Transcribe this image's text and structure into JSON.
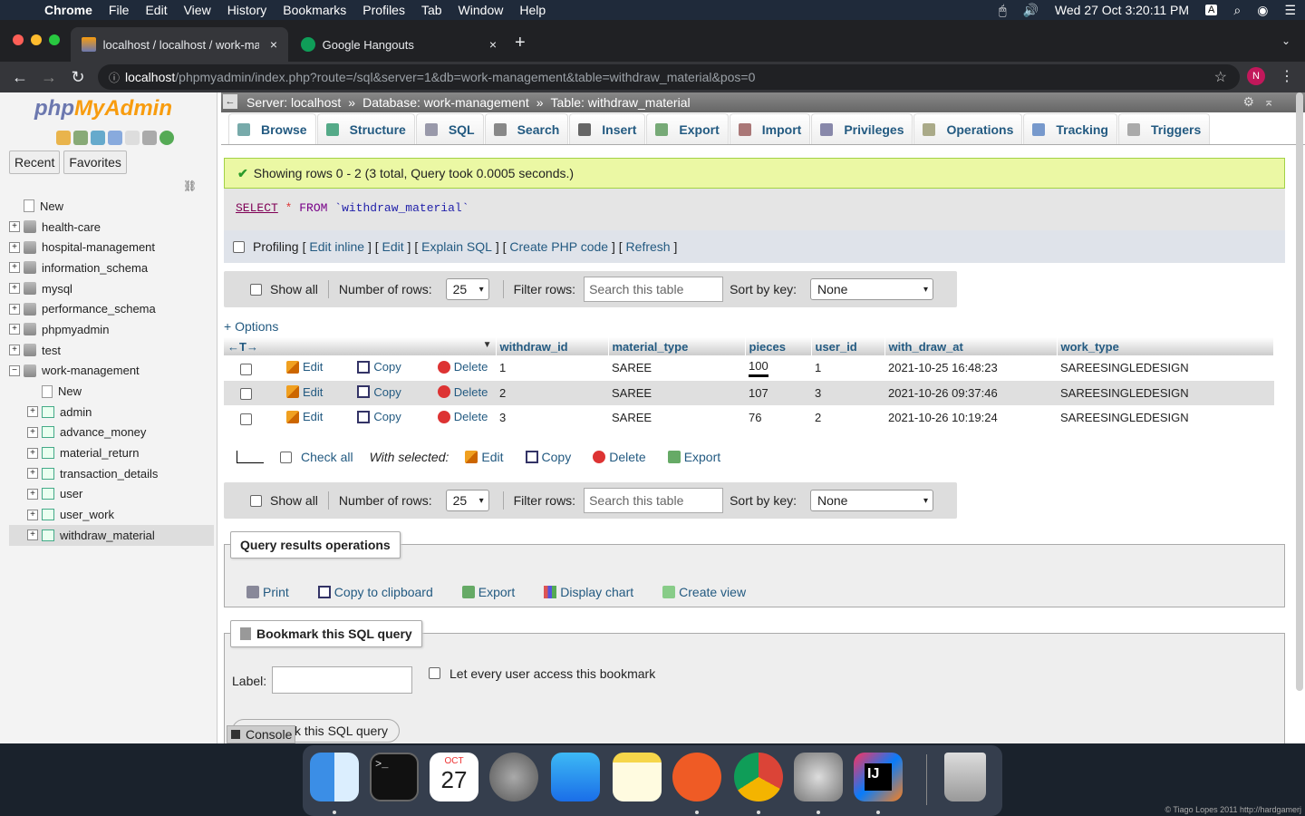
{
  "menubar": {
    "app": "Chrome",
    "items": [
      "File",
      "Edit",
      "View",
      "History",
      "Bookmarks",
      "Profiles",
      "Tab",
      "Window",
      "Help"
    ],
    "datetime": "Wed 27 Oct  3:20:11 PM",
    "input_indicator": "A"
  },
  "tabs": [
    {
      "title": "localhost / localhost / work-ma",
      "close": "×"
    },
    {
      "title": "Google Hangouts",
      "close": "×"
    }
  ],
  "newtab": "+",
  "address": {
    "host": "localhost",
    "path": "/phpmyadmin/index.php?route=/sql&server=1&db=work-management&table=withdraw_material&pos=0",
    "profile_initial": "N"
  },
  "nav": {
    "logo_php": "php",
    "logo_my": "MyAdmin",
    "tabs": [
      "Recent",
      "Favorites"
    ],
    "tree": [
      {
        "label": "New",
        "type": "new",
        "level": 0
      },
      {
        "label": "health-care",
        "type": "db",
        "level": 0
      },
      {
        "label": "hospital-management",
        "type": "db",
        "level": 0
      },
      {
        "label": "information_schema",
        "type": "db",
        "level": 0
      },
      {
        "label": "mysql",
        "type": "db",
        "level": 0
      },
      {
        "label": "performance_schema",
        "type": "db",
        "level": 0
      },
      {
        "label": "phpmyadmin",
        "type": "db",
        "level": 0
      },
      {
        "label": "test",
        "type": "db",
        "level": 0
      },
      {
        "label": "work-management",
        "type": "db-open",
        "level": 0
      },
      {
        "label": "New",
        "type": "new",
        "level": 1
      },
      {
        "label": "admin",
        "type": "table",
        "level": 1
      },
      {
        "label": "advance_money",
        "type": "table",
        "level": 1
      },
      {
        "label": "material_return",
        "type": "table",
        "level": 1
      },
      {
        "label": "transaction_details",
        "type": "table",
        "level": 1
      },
      {
        "label": "user",
        "type": "table",
        "level": 1
      },
      {
        "label": "user_work",
        "type": "table",
        "level": 1
      },
      {
        "label": "withdraw_material",
        "type": "table",
        "level": 1,
        "selected": true
      }
    ]
  },
  "breadcrumb": {
    "server": "Server: localhost",
    "database": "Database: work-management",
    "table": "Table: withdraw_material",
    "sep": "»"
  },
  "menu_tabs": [
    "Browse",
    "Structure",
    "SQL",
    "Search",
    "Insert",
    "Export",
    "Import",
    "Privileges",
    "Operations",
    "Tracking",
    "Triggers"
  ],
  "success_message": "Showing rows 0 - 2 (3 total, Query took 0.0005 seconds.)",
  "sql": {
    "select": "SELECT",
    "star": "*",
    "from": "FROM",
    "table": "`withdraw_material`"
  },
  "profiling": {
    "label": "Profiling",
    "links": [
      "Edit inline",
      "Edit",
      "Explain SQL",
      "Create PHP code",
      "Refresh"
    ]
  },
  "navigation": {
    "show_all": "Show all",
    "number_of_rows_label": "Number of rows:",
    "number_of_rows": "25",
    "filter_label": "Filter rows:",
    "filter_placeholder": "Search this table",
    "sort_label": "Sort by key:",
    "sort_value": "None"
  },
  "options_link": "+ Options",
  "table": {
    "columns": [
      "withdraw_id",
      "material_type",
      "pieces",
      "user_id",
      "with_draw_at",
      "work_type"
    ],
    "actions": {
      "edit": "Edit",
      "copy": "Copy",
      "delete": "Delete"
    },
    "rows": [
      [
        "1",
        "SAREE",
        "100",
        "1",
        "2021-10-25 16:48:23",
        "SAREESINGLEDESIGN"
      ],
      [
        "2",
        "SAREE",
        "107",
        "3",
        "2021-10-26 09:37:46",
        "SAREESINGLEDESIGN"
      ],
      [
        "3",
        "SAREE",
        "76",
        "2",
        "2021-10-26 10:19:24",
        "SAREESINGLEDESIGN"
      ]
    ]
  },
  "with_selected": {
    "check_all": "Check all",
    "label": "With selected:",
    "actions": [
      "Edit",
      "Copy",
      "Delete",
      "Export"
    ]
  },
  "query_results_operations": {
    "title": "Query results operations",
    "links": [
      "Print",
      "Copy to clipboard",
      "Export",
      "Display chart",
      "Create view"
    ]
  },
  "bookmark": {
    "title": "Bookmark this SQL query",
    "label": "Label:",
    "let_every_user": "Let every user access this bookmark",
    "button_partial": "k this SQL query"
  },
  "console_label": "Console",
  "dock": {
    "calendar_month": "OCT",
    "calendar_day": "27",
    "ij": "IJ"
  },
  "credit": "© Tiago Lopes 2011   http://hardgamerj"
}
